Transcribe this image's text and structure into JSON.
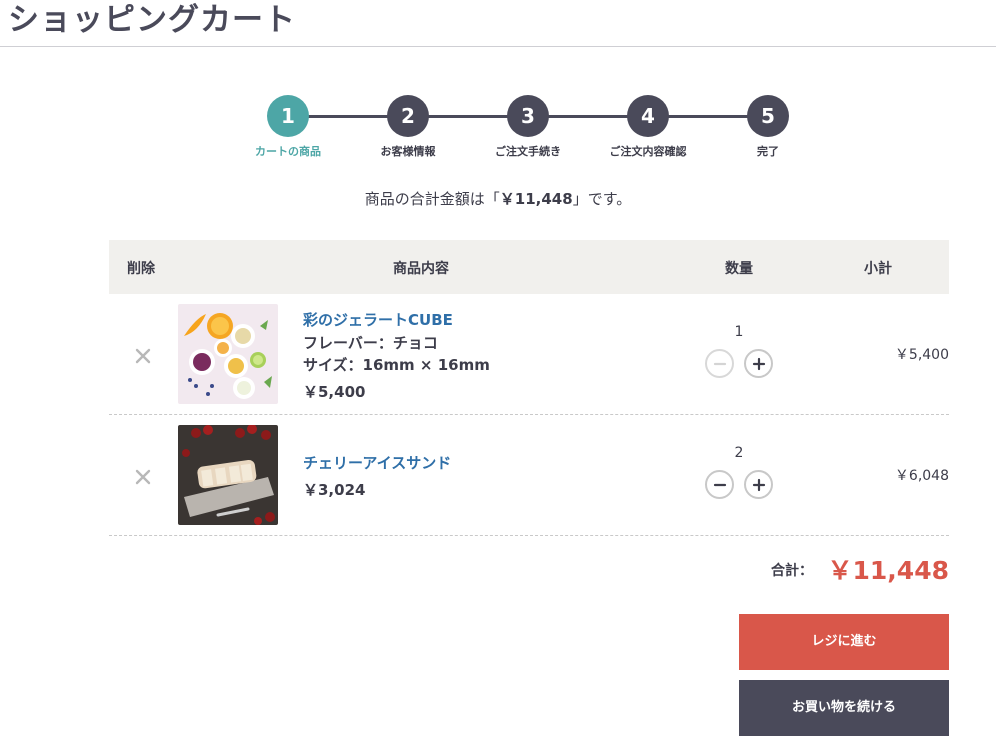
{
  "page_title": "ショッピングカート",
  "steps": [
    {
      "number": "1",
      "label": "カートの商品",
      "active": true
    },
    {
      "number": "2",
      "label": "お客様情報"
    },
    {
      "number": "3",
      "label": "ご注文手続き"
    },
    {
      "number": "4",
      "label": "ご注文内容確認"
    },
    {
      "number": "5",
      "label": "完了"
    }
  ],
  "total_message": {
    "prefix": "商品の合計金額は「",
    "amount": "￥11,448",
    "suffix": "」です。"
  },
  "table": {
    "headers": {
      "delete": "削除",
      "item": "商品内容",
      "quantity": "数量",
      "subtotal": "小計"
    }
  },
  "items": [
    {
      "name": "彩のジェラートCUBE",
      "flavor": "フレーバー：チョコ",
      "size": "サイズ：16mm × 16mm",
      "price": "￥5,400",
      "quantity": "1",
      "subtotal": "￥5,400",
      "image": "gelato-cube-photo"
    },
    {
      "name": "チェリーアイスサンド",
      "price": "￥3,024",
      "quantity": "2",
      "subtotal": "￥6,048",
      "image": "cherry-ice-sandwich-photo"
    }
  ],
  "grand_total": {
    "label": "合計：",
    "value": "￥11,448"
  },
  "buttons": {
    "checkout": "レジに進む",
    "continue": "お買い物を続ける"
  },
  "colors": {
    "accent_teal": "#4da6a6",
    "dark": "#4a4a5a",
    "price_red": "#d9574a",
    "link_blue": "#2f6fa8"
  },
  "icons": {
    "remove": "close-icon",
    "decrement": "minus-icon",
    "increment": "plus-icon"
  }
}
